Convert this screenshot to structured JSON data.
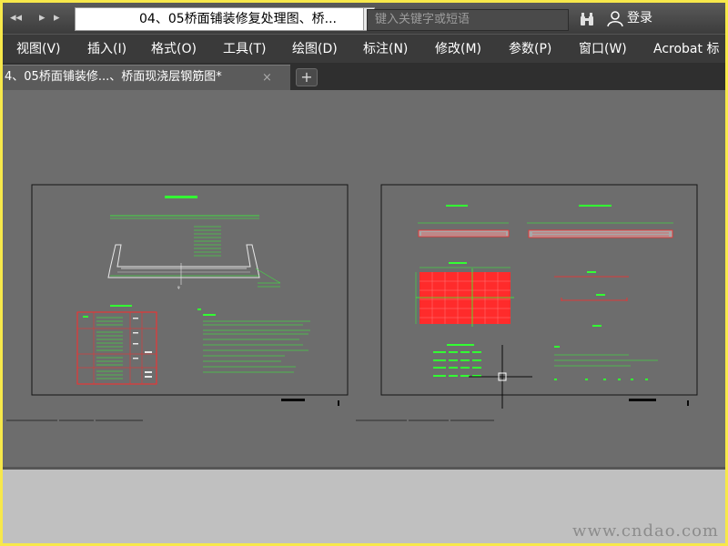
{
  "window": {
    "title": "04、05桥面铺装修复处理图、桥...",
    "search_placeholder": "键入关键字或短语",
    "login_label": "登录"
  },
  "menu": [
    "视图(V)",
    "插入(I)",
    "格式(O)",
    "工具(T)",
    "绘图(D)",
    "标注(N)",
    "修改(M)",
    "参数(P)",
    "窗口(W)",
    "Acrobat 标"
  ],
  "tabs": {
    "active_label": "4、05桥面铺装修...、桥面现浇层钢筋图*",
    "close_symbol": "×",
    "new_symbol": "+"
  },
  "icons": {
    "quick_access": "undo-redo-icon",
    "search": "binoculars-icon",
    "user": "user-icon",
    "crosshair": "crosshair-cursor-icon"
  },
  "colors": {
    "background": "#6d6d6d",
    "drawing_green": "#33ff33",
    "drawing_red": "#ff2b2b",
    "text_white": "#ffffff",
    "frame_yellow": "#f7e84a"
  },
  "watermark": "www.cndao.com"
}
